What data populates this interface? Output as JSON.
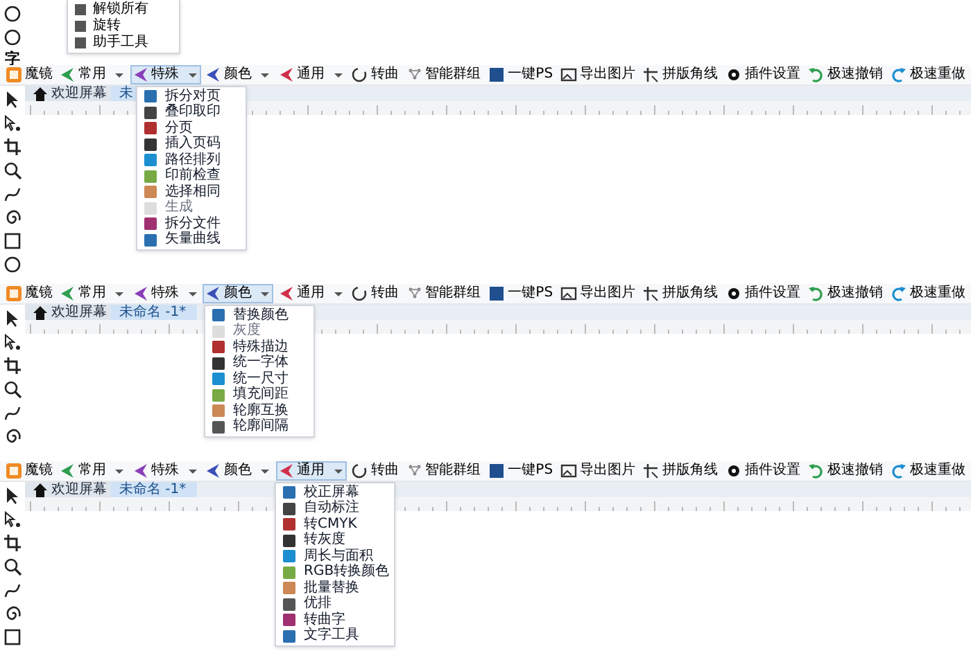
{
  "top_menu": {
    "items": [
      {
        "label": "解锁所有"
      },
      {
        "label": "旋转"
      },
      {
        "label": "助手工具"
      }
    ]
  },
  "toolbox_text": "字",
  "sections": [
    {
      "toolbar": [
        {
          "kind": "logo",
          "label": "魔镜",
          "selected": false
        },
        {
          "kind": "dropdown",
          "label": "常用",
          "color": "#2e9e4f",
          "selected": false
        },
        {
          "kind": "dropdown",
          "label": "特殊",
          "color": "#8a3fb8",
          "selected": true
        },
        {
          "kind": "dropdown",
          "label": "颜色",
          "color": "#3a4fb8",
          "selected": false
        },
        {
          "kind": "dropdown",
          "label": "通用",
          "color": "#d0304a",
          "selected": false
        },
        {
          "kind": "button",
          "label": "转曲",
          "selected": false
        },
        {
          "kind": "button",
          "label": "智能群组",
          "selected": false
        },
        {
          "kind": "button",
          "label": "一键PS",
          "selected": false
        },
        {
          "kind": "button",
          "label": "导出图片",
          "selected": false
        },
        {
          "kind": "button",
          "label": "拼版角线",
          "selected": false
        },
        {
          "kind": "button",
          "label": "插件设置",
          "selected": false
        },
        {
          "kind": "button",
          "label": "极速撤销",
          "selected": false
        },
        {
          "kind": "button",
          "label": "极速重做",
          "selected": false
        }
      ],
      "tabs": [
        {
          "label": "欢迎屏幕",
          "selected": false
        },
        {
          "label": "未",
          "selected": true
        }
      ],
      "menu": [
        {
          "label": "拆分对页",
          "disabled": false
        },
        {
          "label": "叠印取印",
          "disabled": false
        },
        {
          "label": "分页",
          "disabled": false
        },
        {
          "label": "插入页码",
          "disabled": false
        },
        {
          "label": "路径排列",
          "disabled": false
        },
        {
          "label": "印前检查",
          "disabled": false
        },
        {
          "label": "选择相同",
          "disabled": false
        },
        {
          "label": "生成",
          "disabled": true
        },
        {
          "label": "拆分文件",
          "disabled": false
        },
        {
          "label": "矢量曲线",
          "disabled": false
        }
      ]
    },
    {
      "toolbar": [
        {
          "kind": "logo",
          "label": "魔镜",
          "selected": false
        },
        {
          "kind": "dropdown",
          "label": "常用",
          "color": "#2e9e4f",
          "selected": false
        },
        {
          "kind": "dropdown",
          "label": "特殊",
          "color": "#8a3fb8",
          "selected": false
        },
        {
          "kind": "dropdown",
          "label": "颜色",
          "color": "#3a4fb8",
          "selected": true
        },
        {
          "kind": "dropdown",
          "label": "通用",
          "color": "#d0304a",
          "selected": false
        },
        {
          "kind": "button",
          "label": "转曲",
          "selected": false
        },
        {
          "kind": "button",
          "label": "智能群组",
          "selected": false
        },
        {
          "kind": "button",
          "label": "一键PS",
          "selected": false
        },
        {
          "kind": "button",
          "label": "导出图片",
          "selected": false
        },
        {
          "kind": "button",
          "label": "拼版角线",
          "selected": false
        },
        {
          "kind": "button",
          "label": "插件设置",
          "selected": false
        },
        {
          "kind": "button",
          "label": "极速撤销",
          "selected": false
        },
        {
          "kind": "button",
          "label": "极速重做",
          "selected": false
        }
      ],
      "tabs": [
        {
          "label": "欢迎屏幕",
          "selected": false
        },
        {
          "label": "未命名 -1*",
          "selected": true
        }
      ],
      "menu": [
        {
          "label": "替换颜色",
          "disabled": false
        },
        {
          "label": "灰度",
          "disabled": true
        },
        {
          "label": "特殊描边",
          "disabled": false
        },
        {
          "label": "统一字体",
          "disabled": false
        },
        {
          "label": "统一尺寸",
          "disabled": false
        },
        {
          "label": "填充间距",
          "disabled": false
        },
        {
          "label": "轮廓互换",
          "disabled": false
        },
        {
          "label": "轮廓间隔",
          "disabled": false
        }
      ]
    },
    {
      "toolbar": [
        {
          "kind": "logo",
          "label": "魔镜",
          "selected": false
        },
        {
          "kind": "dropdown",
          "label": "常用",
          "color": "#2e9e4f",
          "selected": false
        },
        {
          "kind": "dropdown",
          "label": "特殊",
          "color": "#8a3fb8",
          "selected": false
        },
        {
          "kind": "dropdown",
          "label": "颜色",
          "color": "#3a4fb8",
          "selected": false
        },
        {
          "kind": "dropdown",
          "label": "通用",
          "color": "#d0304a",
          "selected": true
        },
        {
          "kind": "button",
          "label": "转曲",
          "selected": false
        },
        {
          "kind": "button",
          "label": "智能群组",
          "selected": false
        },
        {
          "kind": "button",
          "label": "一键PS",
          "selected": false
        },
        {
          "kind": "button",
          "label": "导出图片",
          "selected": false
        },
        {
          "kind": "button",
          "label": "拼版角线",
          "selected": false
        },
        {
          "kind": "button",
          "label": "插件设置",
          "selected": false
        },
        {
          "kind": "button",
          "label": "极速撤销",
          "selected": false
        },
        {
          "kind": "button",
          "label": "极速重做",
          "selected": false
        }
      ],
      "tabs": [
        {
          "label": "欢迎屏幕",
          "selected": false
        },
        {
          "label": "未命名 -1*",
          "selected": true
        }
      ],
      "menu": [
        {
          "label": "校正屏幕",
          "disabled": false
        },
        {
          "label": "自动标注",
          "disabled": false
        },
        {
          "label": "转CMYK",
          "disabled": false
        },
        {
          "label": "转灰度",
          "disabled": false
        },
        {
          "label": "周长与面积",
          "disabled": false
        },
        {
          "label": "RGB转换颜色",
          "disabled": false
        },
        {
          "label": "批量替换",
          "disabled": false
        },
        {
          "label": "优排",
          "disabled": false
        },
        {
          "label": "转曲字",
          "disabled": false
        },
        {
          "label": "文字工具",
          "disabled": false
        }
      ]
    }
  ]
}
